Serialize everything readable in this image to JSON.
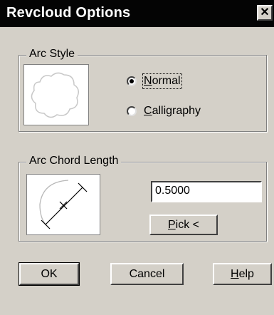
{
  "window": {
    "title": "Revcloud Options",
    "close_symbol": "✕"
  },
  "arc_style": {
    "legend": "Arc Style",
    "options": [
      {
        "label": "Normal",
        "accel": "N",
        "rest": "ormal",
        "selected": true
      },
      {
        "label": "Calligraphy",
        "accel": "C",
        "rest": "alligraphy",
        "selected": false
      }
    ]
  },
  "arc_chord": {
    "legend": "Arc Chord Length",
    "value": "0.5000",
    "pick_button": {
      "accel": "P",
      "rest": "ick <"
    }
  },
  "buttons": {
    "ok": "OK",
    "cancel": "Cancel",
    "help": {
      "accel": "H",
      "rest": "elp"
    }
  },
  "colors": {
    "titlebar": "#040404",
    "face": "#d4d0c8"
  },
  "icons": [
    "close-icon",
    "cloud-preview-icon",
    "chord-preview-icon"
  ]
}
